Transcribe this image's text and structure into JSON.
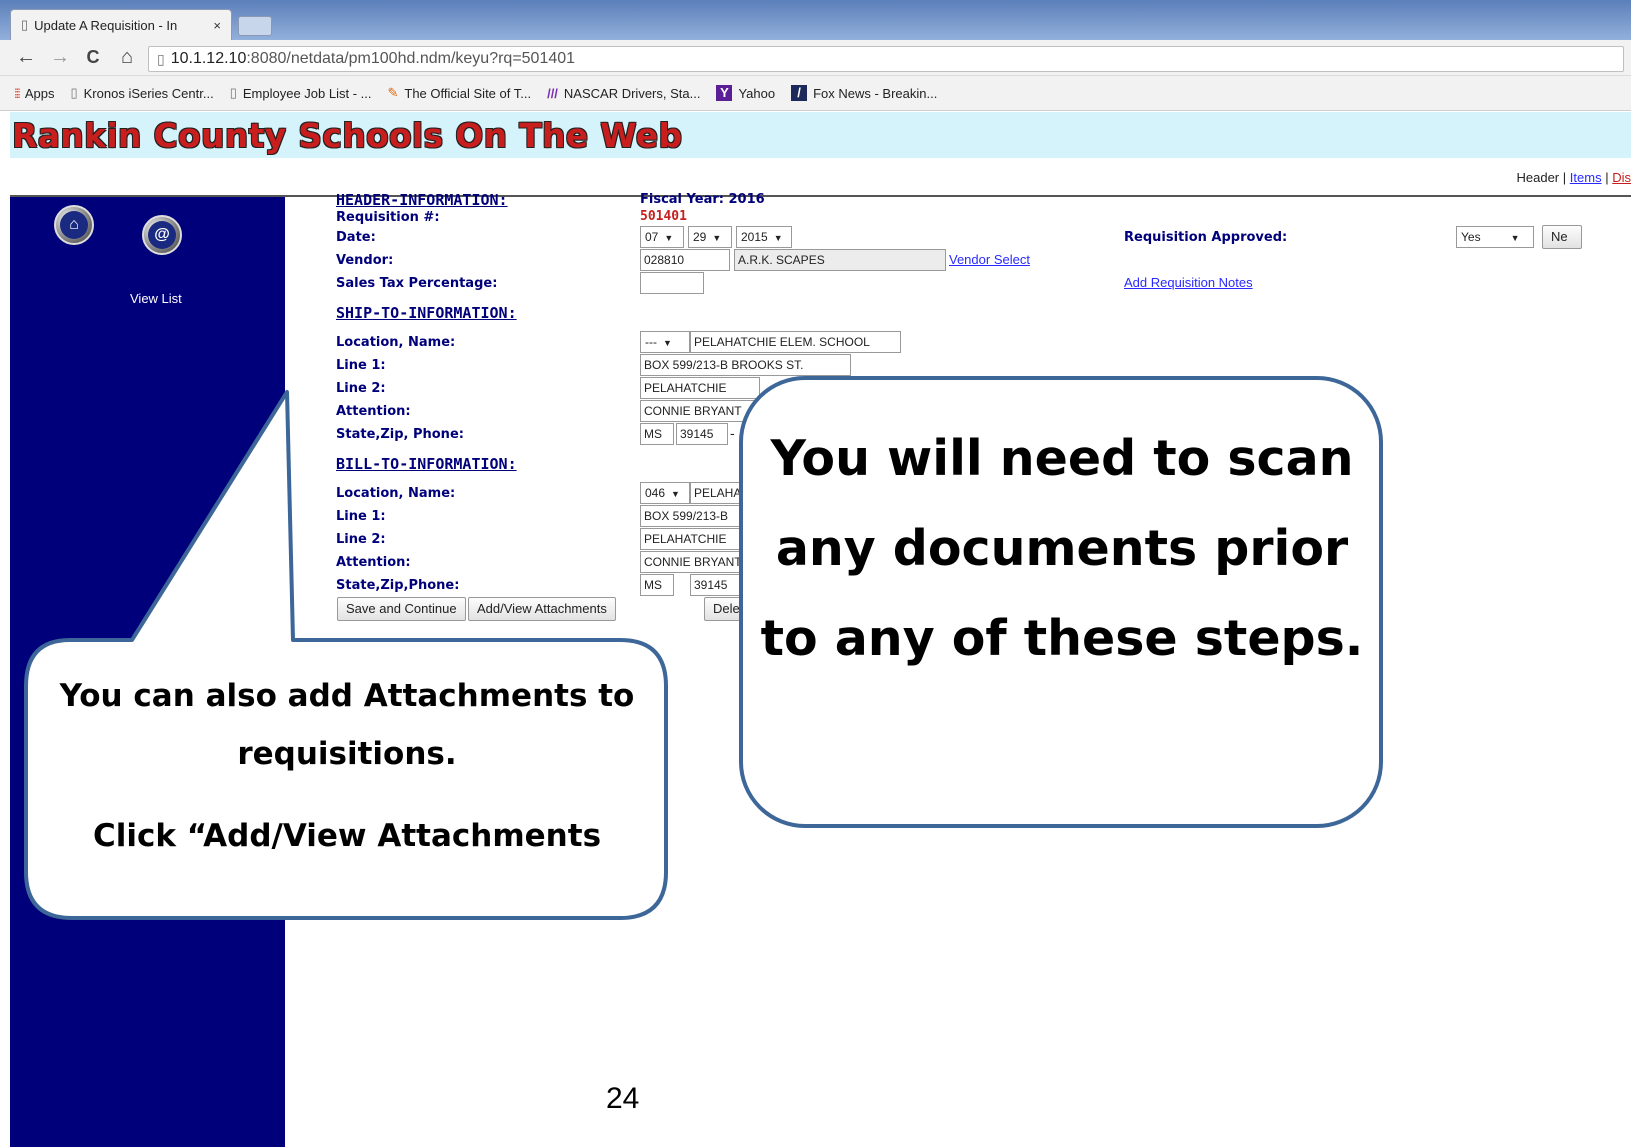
{
  "browser": {
    "tab_title": "Update A Requisition - In",
    "tab_close": "×",
    "url_host": "10.1.12.10",
    "url_path": ":8080/netdata/pm100hd.ndm/keyu?rq=501401",
    "nav": {
      "back_glyph": "←",
      "forward_glyph": "→",
      "reload_glyph": "C",
      "home_glyph": "⌂"
    },
    "bookmarks": [
      {
        "label": "Apps",
        "icon": "apps-grid-icon"
      },
      {
        "label": "Kronos iSeries Centr...",
        "icon": "page-icon"
      },
      {
        "label": "Employee Job List - ...",
        "icon": "page-icon"
      },
      {
        "label": "The Official Site of T...",
        "icon": "orange-logo-icon"
      },
      {
        "label": "NASCAR Drivers, Sta...",
        "icon": "nascar-icon"
      },
      {
        "label": "Yahoo",
        "icon": "yahoo-icon"
      },
      {
        "label": "Fox News - Breakin...",
        "icon": "fox-news-icon"
      }
    ]
  },
  "site": {
    "title": "Rankin County Schools On The Web",
    "topnav": {
      "header": "Header",
      "sep": "|",
      "items": "Items",
      "dist": "Dis"
    }
  },
  "sidebar": {
    "home_icon": "home-icon",
    "email_icon": "at-sign-icon",
    "email_glyph": "@",
    "view_list": "View List"
  },
  "form": {
    "header_section": "HEADER-INFORMATION:",
    "fiscal_year_label": "Fiscal Year:",
    "fiscal_year": "2016",
    "requisition_label": "Requisition #:",
    "requisition_number": "501401",
    "date_label": "Date:",
    "date_month": "07",
    "date_day": "29",
    "date_year": "2015",
    "vendor_label": "Vendor:",
    "vendor_code": "028810",
    "vendor_name": "A.R.K. SCAPES",
    "vendor_select": "Vendor Select",
    "sales_tax_label": "Sales Tax Percentage:",
    "sales_tax_value": "",
    "requisition_approved_label": "Requisition Approved:",
    "requisition_approved_value": "Yes",
    "approved_next_btn": "Ne",
    "add_notes": "Add Requisition Notes",
    "ship_section": "SHIP-TO-INFORMATION:",
    "ship": {
      "location_label": "Location, Name:",
      "location_code": "---",
      "location_name": "PELAHATCHIE ELEM. SCHOOL",
      "line1_label": "Line 1:",
      "line1": "BOX 599/213-B BROOKS ST.",
      "line2_label": "Line 2:",
      "line2": "PELAHATCHIE",
      "attention_label": "Attention:",
      "attention": "CONNIE BRYANT",
      "state_label": "State,Zip, Phone:",
      "state": "MS",
      "zip": "39145",
      "phone_sep": "-"
    },
    "bill_section": "BILL-TO-INFORMATION:",
    "bill": {
      "location_label": "Location, Name:",
      "location_code": "046",
      "location_name": "PELAHAT",
      "line1_label": "Line 1:",
      "line1": "BOX 599/213-B",
      "line2_label": "Line 2:",
      "line2": "PELAHATCHIE",
      "attention_label": "Attention:",
      "attention": "CONNIE BRYANT",
      "state_label": "State,Zip,Phone:",
      "state": "MS",
      "zip": "39145"
    },
    "save_continue": "Save and Continue",
    "add_view_attachments": "Add/View Attachments",
    "delete_partial": "Delet"
  },
  "callouts": {
    "left_line1": "You can also add Attachments to",
    "left_line2": "requisitions.",
    "left_line3": "Click “Add/View Attachments",
    "right_text": "You will need to scan any documents prior to any of these steps."
  },
  "page_number": "24",
  "colors": {
    "sidebar_blue": "#00007a",
    "banner_bg": "#d4f3fb",
    "site_title_red": "#c81e1e",
    "callout_border": "#3d6699"
  }
}
